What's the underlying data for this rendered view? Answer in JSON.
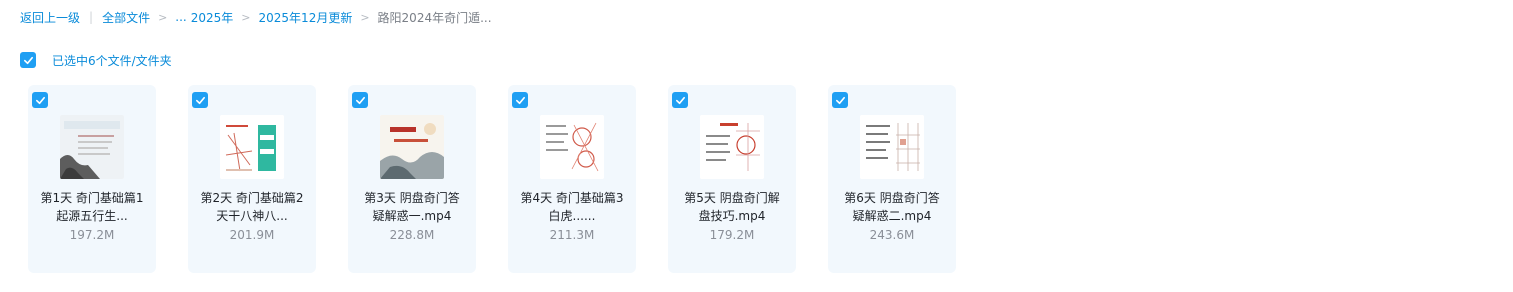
{
  "breadcrumb": {
    "back": "返回上一级",
    "all_files": "全部文件",
    "ellipsis": "...",
    "year": "2025年",
    "month_update": "2025年12月更新",
    "current": "路阳2024年奇门遁..."
  },
  "selection": {
    "label": "已选中6个文件/文件夹"
  },
  "files": [
    {
      "name_line1": "第1天 奇门基础篇1",
      "name_line2": "起源五行生...",
      "size": "197.2M"
    },
    {
      "name_line1": "第2天 奇门基础篇2",
      "name_line2": "天干八神八...",
      "size": "201.9M"
    },
    {
      "name_line1": "第3天 阴盘奇门答",
      "name_line2": "疑解惑一.mp4",
      "size": "228.8M"
    },
    {
      "name_line1": "第4天 奇门基础篇3",
      "name_line2": "白虎......",
      "size": "211.3M"
    },
    {
      "name_line1": "第5天 阴盘奇门解",
      "name_line2": "盘技巧.mp4",
      "size": "179.2M"
    },
    {
      "name_line1": "第6天 阴盘奇门答",
      "name_line2": "疑解惑二.mp4",
      "size": "243.6M"
    }
  ],
  "colors": {
    "accent": "#1f9ff3",
    "link": "#0a8bd9",
    "card_bg": "#f2f8fd"
  }
}
